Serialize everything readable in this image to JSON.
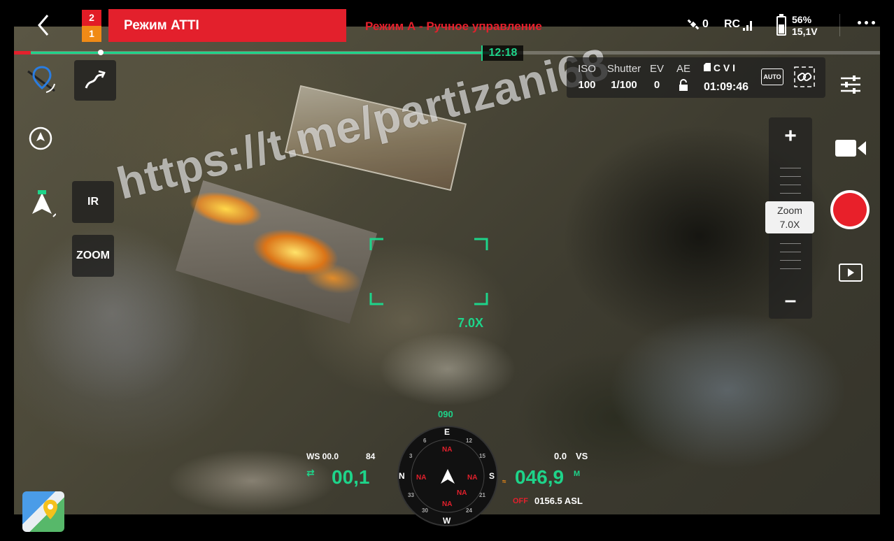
{
  "watermark": "https://t.me/partizani68",
  "topbar": {
    "gps_top": "2",
    "gps_bottom": "1",
    "mode": "Режим ATTI",
    "subtitle": "Режим А - Ручное управление",
    "satellites": "0",
    "rc_label": "RC",
    "battery_percent": "56%",
    "battery_voltage": "15,1V"
  },
  "timeline": {
    "time": "12:18",
    "progress_fraction": 0.54
  },
  "left_controls": {
    "ir_label": "IR",
    "zoom_label": "ZOOM"
  },
  "camera_params": {
    "iso_label": "ISO",
    "iso_value": "100",
    "shutter_label": "Shutter",
    "shutter_value": "1/100",
    "ev_label": "EV",
    "ev_value": "0",
    "ae_label": "AE",
    "storage_label": "C V I",
    "record_time": "01:09:46",
    "auto_label": "AUTO"
  },
  "zoom": {
    "title": "Zoom",
    "value": "7.0X",
    "reticle_value": "7.0X",
    "plus": "+",
    "minus": "–"
  },
  "telemetry": {
    "heading": "090",
    "ws": "WS 00.0",
    "ws_dir": "84",
    "horizontal_speed": "00,1",
    "vertical_speed_value": "0.0",
    "vs_label": "VS",
    "altitude": "046,9",
    "altitude_unit": "M",
    "asl_off": "OFF",
    "asl": "0156.5 ASL"
  },
  "compass": {
    "cardinals": {
      "north": "N",
      "east": "E",
      "south": "S",
      "west": "W"
    },
    "markers": [
      "NA",
      "NA",
      "NA",
      "NA",
      "NA"
    ],
    "ticks": [
      "12",
      "15",
      "21",
      "24",
      "30",
      "33",
      "3",
      "6"
    ]
  },
  "colors": {
    "accent": "#1ed48a",
    "alert": "#e3202c",
    "warning": "#f08a16"
  }
}
